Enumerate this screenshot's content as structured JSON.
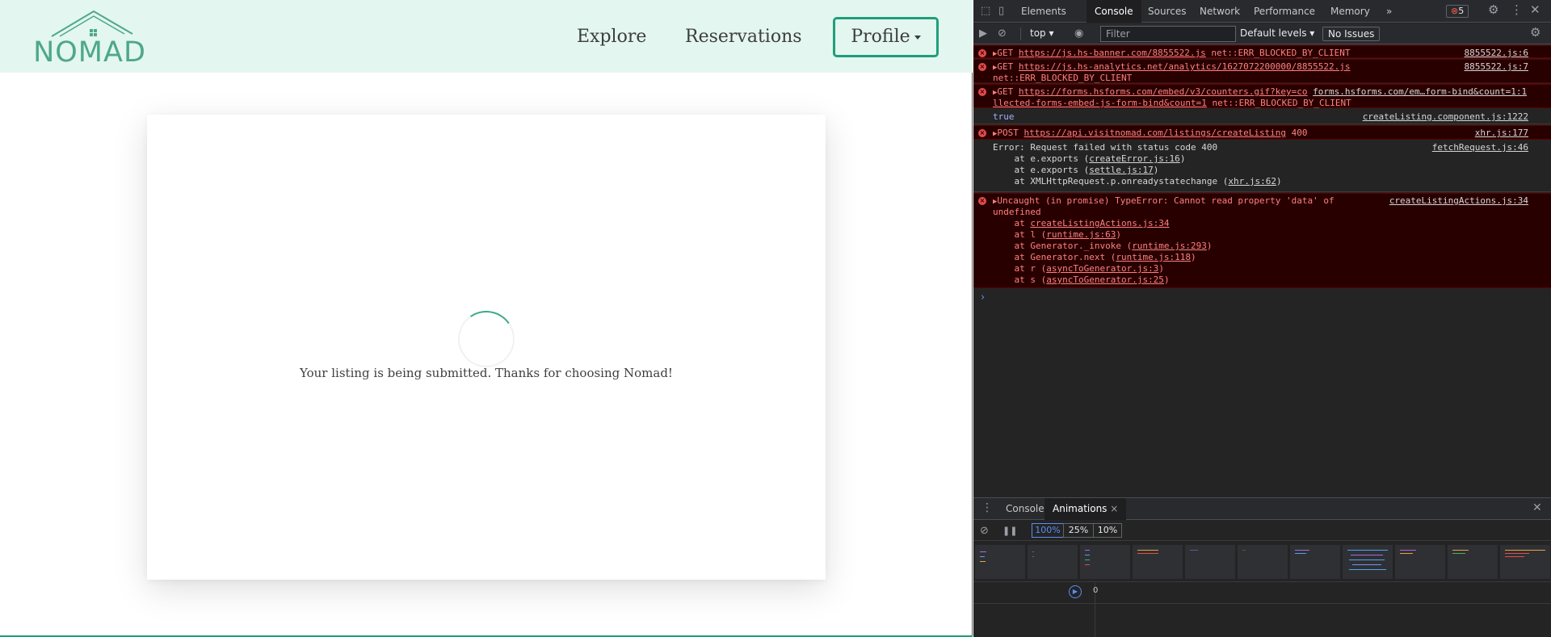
{
  "site": {
    "logo_text": "NOMAD",
    "nav": {
      "explore": "Explore",
      "reservations": "Reservations",
      "profile": "Profile"
    },
    "message": "Your listing is being submitted. Thanks for choosing Nomad!",
    "accent_color": "#1f9e7a"
  },
  "devtools": {
    "tabs": [
      "Elements",
      "Console",
      "Sources",
      "Network",
      "Performance",
      "Memory"
    ],
    "active_tab": "Console",
    "more_tabs": "»",
    "error_count": "5",
    "context": "top ▾",
    "filter_placeholder": "Filter",
    "levels": "Default levels ▾",
    "issues": "No Issues",
    "logs": {
      "r1": {
        "method": "GET",
        "url": "https://js.hs-banner.com/8855522.js",
        "tail": " net::ERR_BLOCKED_BY_CLIENT",
        "source": "8855522.js:6"
      },
      "r2": {
        "method": "GET",
        "url": "https://js.hs-analytics.net/analytics/1627072200000/8855522.js",
        "tail": "net::ERR_BLOCKED_BY_CLIENT",
        "source": "8855522.js:7"
      },
      "r3": {
        "method": "GET",
        "url": "https://forms.hsforms.com/embed/v3/counters.gif?key=co",
        "url2": "forms.hsforms.com/em…form-bind&count=1:1",
        "line2": "llected-forms-embed-js-form-bind&count=1",
        "tail": " net::ERR_BLOCKED_BY_CLIENT"
      },
      "r4": {
        "text": "true",
        "source": "createListing.component.js:1222"
      },
      "r5": {
        "method": "POST",
        "url": "https://api.visitnomad.com/listings/createListing",
        "status": " 400",
        "source": "xhr.js:177"
      },
      "r6": {
        "line1": "Error: Request failed with status code 400",
        "source": "fetchRequest.js:46",
        "l2a": "    at e.exports (",
        "l2b": "createError.js:16",
        "l2c": ")",
        "l3a": "    at e.exports (",
        "l3b": "settle.js:17",
        "l3c": ")",
        "l4a": "    at XMLHttpRequest.p.onreadystatechange (",
        "l4b": "xhr.js:62",
        "l4c": ")"
      },
      "r7": {
        "line1": "Uncaught (in promise) TypeError: Cannot read property 'data' of",
        "line2": "undefined",
        "source": "createListingActions.js:34",
        "s1a": "    at ",
        "s1b": "createListingActions.js:34",
        "s1c": "",
        "s2a": "    at l (",
        "s2b": "runtime.js:63",
        "s2c": ")",
        "s3a": "    at Generator._invoke (",
        "s3b": "runtime.js:293",
        "s3c": ")",
        "s4a": "    at Generator.next (",
        "s4b": "runtime.js:118",
        "s4c": ")",
        "s5a": "    at r (",
        "s5b": "asyncToGenerator.js:3",
        "s5c": ")",
        "s6a": "    at s (",
        "s6b": "asyncToGenerator.js:25",
        "s6c": ")"
      }
    },
    "prompt": "›",
    "drawer": {
      "tab_console": "Console",
      "tab_animations": "Animations",
      "close_tab": "×",
      "speeds": [
        "100%",
        "25%",
        "10%"
      ],
      "timeline_zero": "0"
    }
  }
}
